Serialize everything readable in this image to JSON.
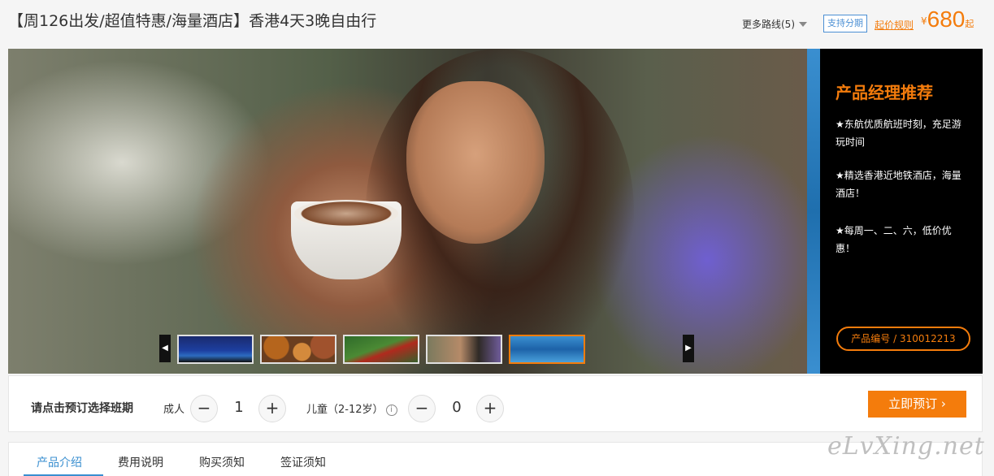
{
  "header": {
    "title": "【周126出发/超值特惠/海量酒店】香港4天3晚自由行",
    "routes_label": "更多路线(5)",
    "installment_label": "支持分期",
    "price_rule_label": "起价规则",
    "currency": "¥",
    "price": "680",
    "price_suffix": "起"
  },
  "banner": {
    "thumbnails": [
      "香港夜景",
      "美食",
      "观光",
      "人物",
      "海洋"
    ],
    "prev_arrow": "◀",
    "next_arrow": "▶"
  },
  "recommendation": {
    "title": "产品经理推荐",
    "items": [
      "★东航优质航班时刻，充足游玩时间",
      "★精选香港近地铁酒店，海量酒店！",
      "★每周一、二、六，低价优惠！"
    ],
    "product_no": "产品编号  /  310012213"
  },
  "booking": {
    "label": "请点击预订选择班期",
    "adult_label": "成人",
    "adult_count": "1",
    "child_label": "儿童（2-12岁）",
    "child_count": "0",
    "minus": "−",
    "plus": "+",
    "info": "i",
    "book_label": "立即预订 ›"
  },
  "tabs": [
    "产品介绍",
    "费用说明",
    "购买须知",
    "签证须知"
  ],
  "watermark": "eLvXing.net",
  "colors": {
    "accent": "#f47c0c",
    "link": "#3a8fd0"
  }
}
